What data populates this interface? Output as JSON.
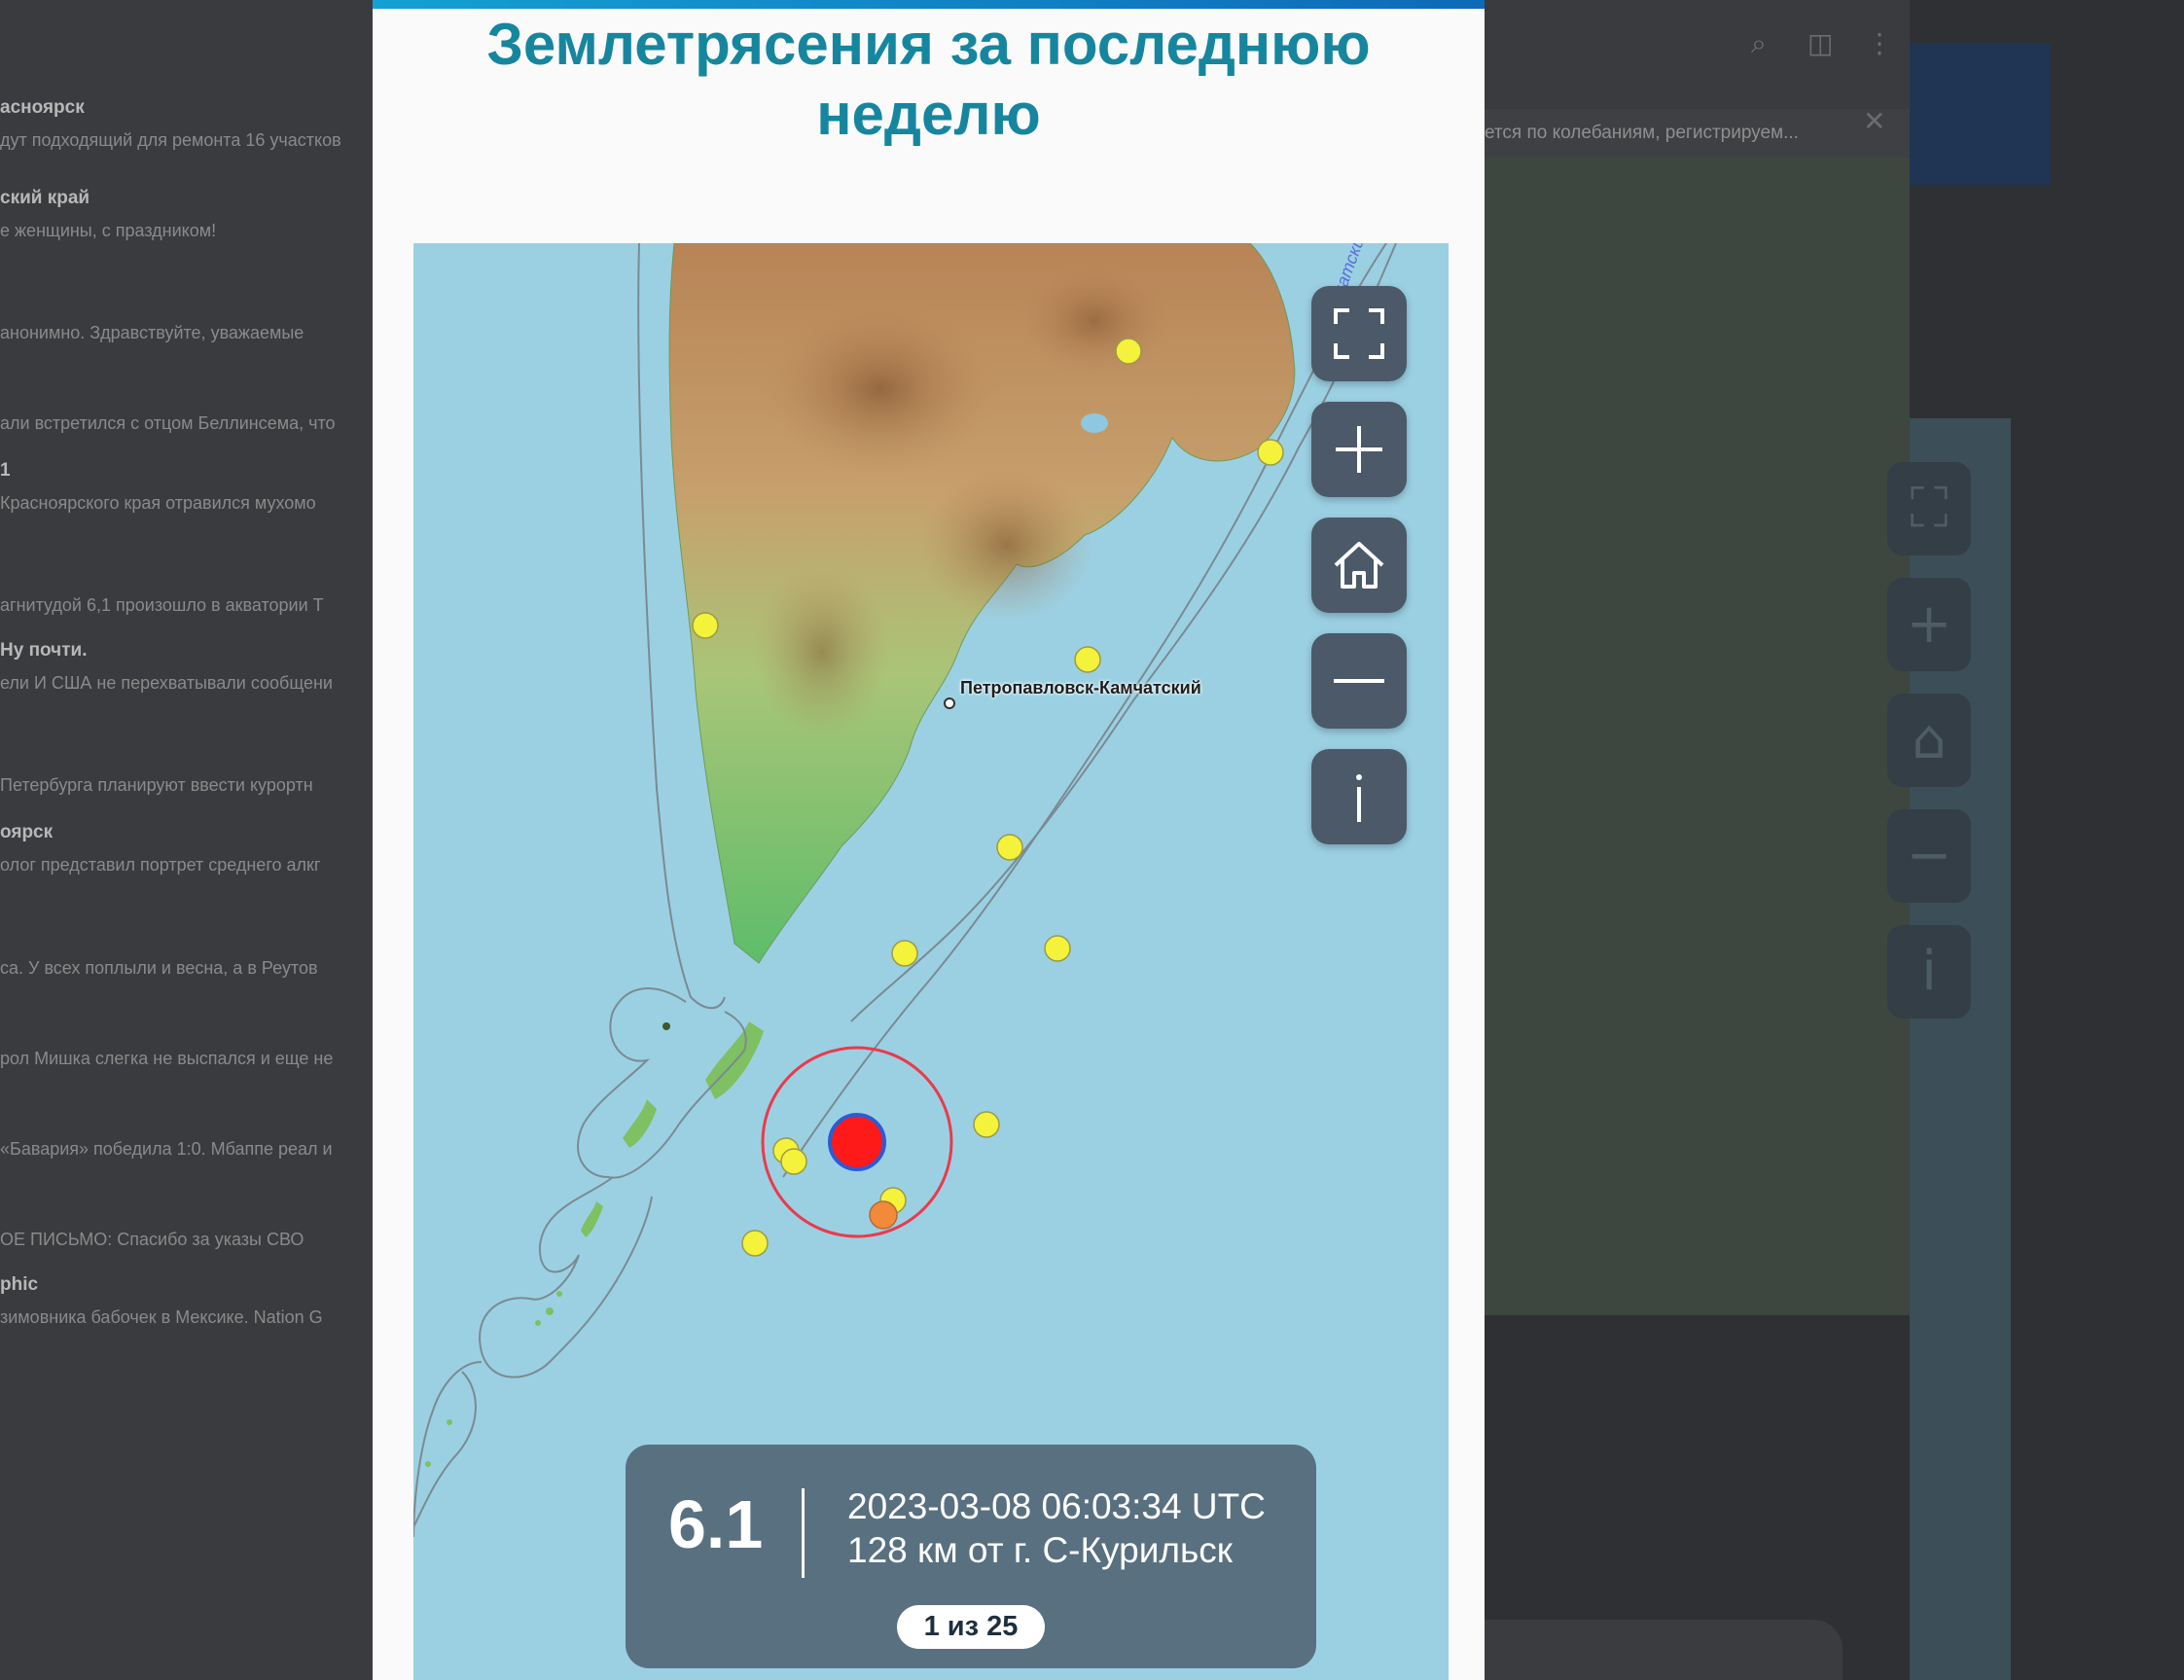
{
  "modal": {
    "title_line1": "Землетрясения за последнюю",
    "title_line2": "неделю"
  },
  "map": {
    "place_label": "Петропавловск-Камчатский",
    "sea_label": "Камчатский",
    "controls": [
      {
        "name": "fullscreen-icon"
      },
      {
        "name": "zoom-in-icon"
      },
      {
        "name": "home-icon"
      },
      {
        "name": "zoom-out-icon"
      },
      {
        "name": "info-icon"
      }
    ]
  },
  "quake": {
    "magnitude": "6.1",
    "datetime": "2023-03-08 06:03:34 UTC",
    "location": "128 км от г. С-Курильск",
    "counter": "1 из 25"
  },
  "colors": {
    "title": "#16869f",
    "sea": "#9bd0e3",
    "event_marker": "#ff1a1a",
    "other_event": "#f4f23a",
    "control_bg": "#4b5968"
  },
  "background": {
    "feed": [
      {
        "title": "асноярск",
        "preview": "дут подходящий для ремонта 16 участков"
      },
      {
        "title": "ский край",
        "preview": "е женщины, с праздником!"
      },
      {
        "title": "",
        "preview": "анонимно. Здравствуйте, уважаемые"
      },
      {
        "title": "",
        "preview": "али встретился с отцом Беллинсема, что"
      },
      {
        "title": "1",
        "preview": "Красноярского края отравился мухомо"
      },
      {
        "title": "",
        "preview": "агнитудой 6,1 произошло в акватории Т"
      },
      {
        "title": "Ну почти.",
        "preview": "ели И США не перехватывали сообщени"
      },
      {
        "title": "",
        "preview": "Петербурга планируют ввести курортн"
      },
      {
        "title": "оярск",
        "preview": "олог представил портрет среднего алкг"
      },
      {
        "title": "",
        "preview": "са. У всех поплыли и весна, а в Реутов"
      },
      {
        "title": "",
        "preview": "рол Мишка слегка не выспался и еще не"
      },
      {
        "title": "",
        "preview": "«Бавария» победила 1:0. Мбаппе реал и"
      },
      {
        "title": "",
        "preview": "ОЕ ПИСЬМО: Спасибо за указы СВО"
      },
      {
        "title": "phic",
        "preview": "зимовника бабочек в Мексике. Nation G"
      }
    ],
    "notice": "ется по колебаниям, регистрируем..."
  }
}
